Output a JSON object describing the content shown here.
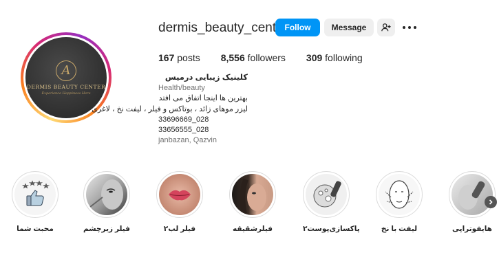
{
  "profile": {
    "username": "dermis_beauty_center",
    "avatar": {
      "monogram": "A",
      "brand": "DERMIS BEAUTY CENTER",
      "tagline": "Experience Happiness Here"
    }
  },
  "actions": {
    "follow": "Follow",
    "message": "Message",
    "add_user_icon": "person-plus-icon",
    "more_icon": "ellipsis-icon"
  },
  "stats": {
    "posts_count": "167",
    "posts_label": "posts",
    "followers_count": "8,556",
    "followers_label": "followers",
    "following_count": "309",
    "following_label": "following"
  },
  "bio": {
    "name": "کلینیک زیبایی درمیس",
    "category": "Health/beauty",
    "line1": "بهترین ها اینجا اتفاق می افتد",
    "line2": "لیزر موهای زائد ، بوتاکس و فیلر ، لیفت نخ ، لاغری",
    "phone1": "33696669_028",
    "phone2": "33656555_028",
    "location": "janbazan, Qazvin"
  },
  "highlights": [
    {
      "label": "محبت شما"
    },
    {
      "label": "فیلر زیرچشم"
    },
    {
      "label": "فیلر لب۲"
    },
    {
      "label": "فیلرشقیقه"
    },
    {
      "label": "پاکسازی‌پوست۲"
    },
    {
      "label": "لیفت با نخ"
    },
    {
      "label": "هایفوتراپی"
    }
  ],
  "colors": {
    "follow_blue": "#0095f6",
    "button_gray": "#efefef",
    "text": "#262626",
    "muted": "#737373"
  }
}
